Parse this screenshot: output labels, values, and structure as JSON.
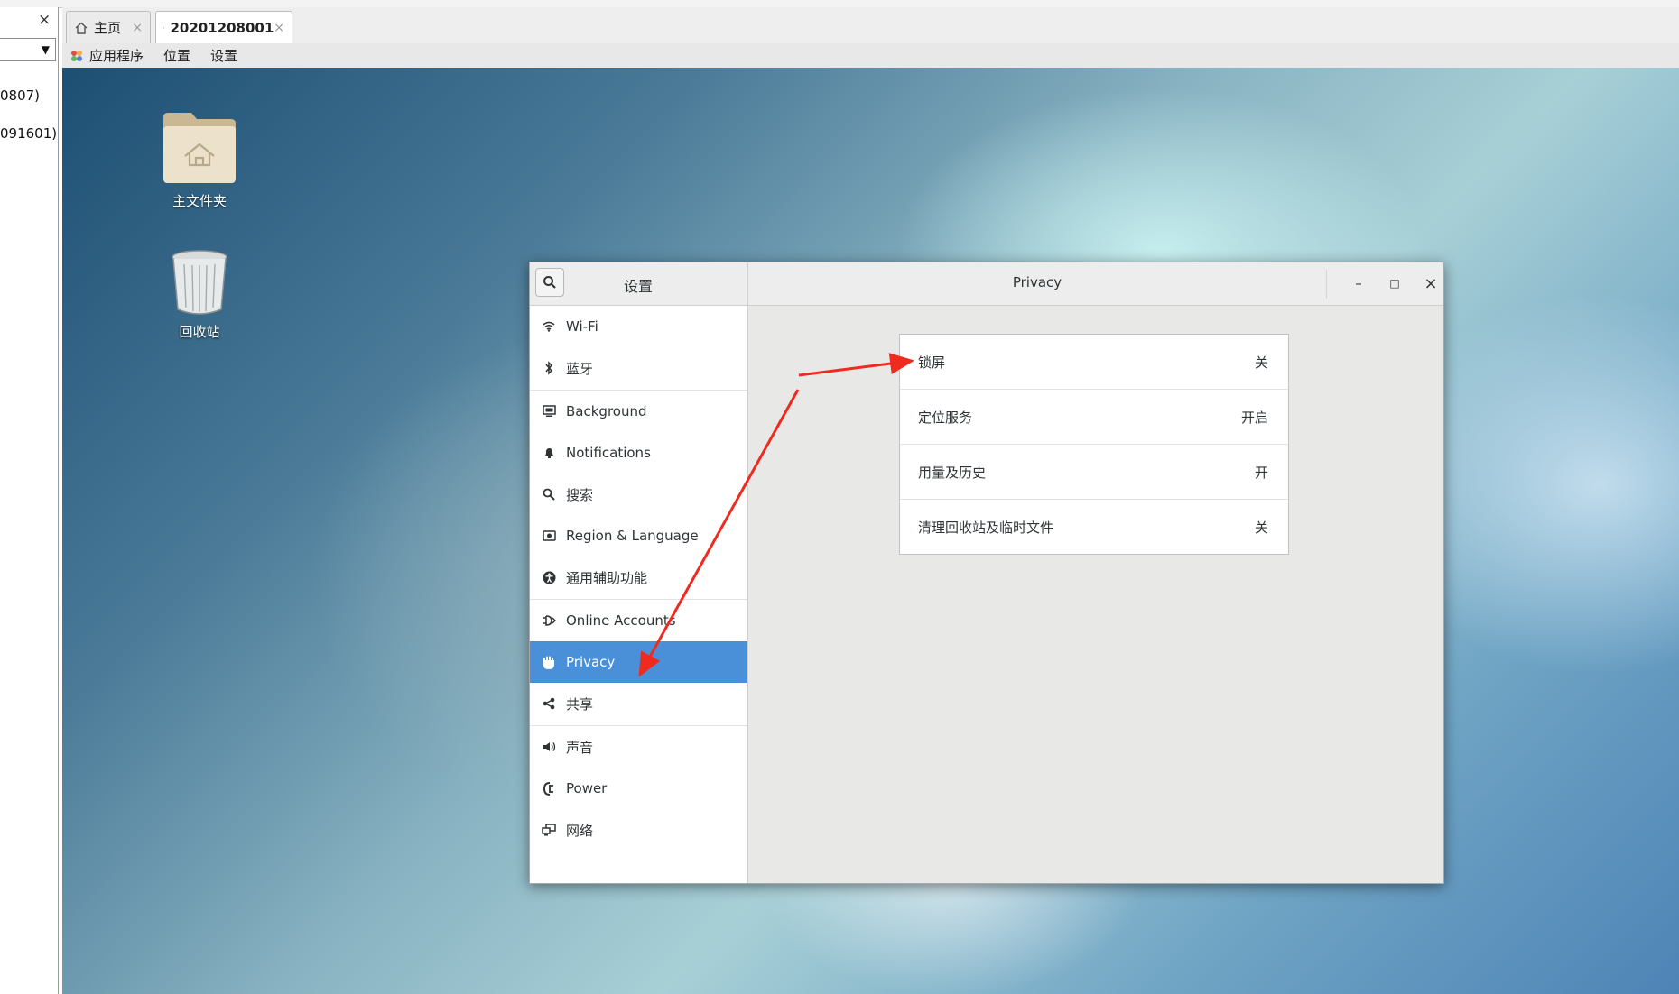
{
  "host": {
    "close_glyph": "×",
    "list_items": [
      "0807)",
      "091601)"
    ]
  },
  "vm_tabs": [
    {
      "label": "主页",
      "close": "×"
    },
    {
      "label": "20201208001",
      "close": "×"
    }
  ],
  "gnome_bar": {
    "apps": "应用程序",
    "places": "位置",
    "settings": "设置"
  },
  "desktop_icons": [
    {
      "label": "主文件夹",
      "icon": "home-folder-icon"
    },
    {
      "label": "回收站",
      "icon": "trash-icon"
    }
  ],
  "settings_window": {
    "left_title": "设置",
    "right_title": "Privacy",
    "controls": {
      "minimize": "–",
      "maximize": "□",
      "close": "×"
    },
    "sidebar": [
      {
        "label": "Wi-Fi",
        "icon": "wifi-icon"
      },
      {
        "label": "蓝牙",
        "icon": "bluetooth-icon"
      },
      {
        "label": "Background",
        "icon": "background-icon"
      },
      {
        "label": "Notifications",
        "icon": "bell-icon"
      },
      {
        "label": "搜索",
        "icon": "search-icon"
      },
      {
        "label": "Region & Language",
        "icon": "region-icon"
      },
      {
        "label": "通用辅助功能",
        "icon": "accessibility-icon"
      },
      {
        "label": "Online Accounts",
        "icon": "online-accounts-icon"
      },
      {
        "label": "Privacy",
        "icon": "hand-icon",
        "selected": true
      },
      {
        "label": "共享",
        "icon": "share-icon"
      },
      {
        "label": "声音",
        "icon": "speaker-icon"
      },
      {
        "label": "Power",
        "icon": "power-icon"
      },
      {
        "label": "网络",
        "icon": "network-icon"
      }
    ],
    "privacy_rows": [
      {
        "label": "锁屏",
        "value": "关"
      },
      {
        "label": "定位服务",
        "value": "开启"
      },
      {
        "label": "用量及历史",
        "value": "开"
      },
      {
        "label": "清理回收站及临时文件",
        "value": "关"
      }
    ]
  },
  "colors": {
    "selection": "#4a90d9",
    "annotation_arrow": "#f02a1e"
  }
}
